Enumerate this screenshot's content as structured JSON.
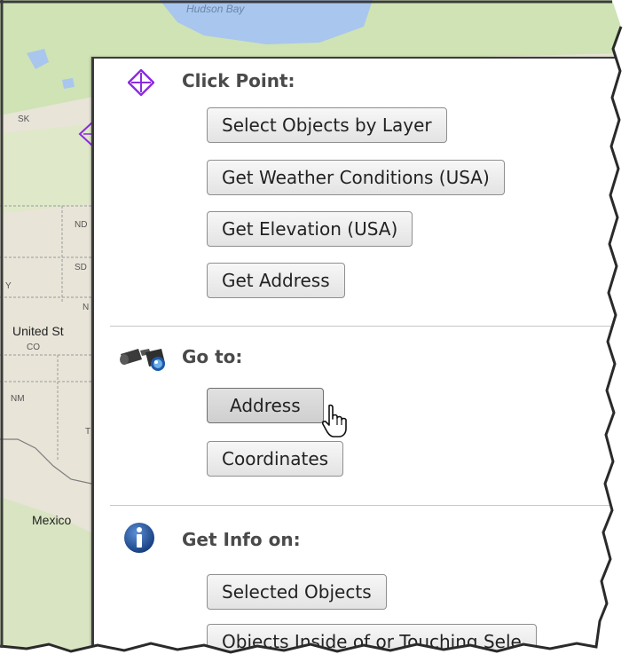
{
  "map": {
    "labels": {
      "hudson_bay": "Hudson Bay",
      "sk": "SK",
      "nd": "ND",
      "sd": "SD",
      "wy": "Y",
      "ne": "N",
      "united_states": "United St",
      "co": "CO",
      "nm": "NM",
      "tx": "T",
      "mexico": "Mexico"
    }
  },
  "menu": {
    "sections": [
      {
        "title": "Click Point:",
        "icon": "diamond-crosshair-icon",
        "buttons": [
          "Select Objects by Layer",
          "Get Weather Conditions (USA)",
          "Get Elevation (USA)",
          "Get Address"
        ]
      },
      {
        "title": "Go to:",
        "icon": "binoculars-icon",
        "buttons": [
          "Address",
          "Coordinates"
        ]
      },
      {
        "title": "Get Info on:",
        "icon": "info-icon",
        "buttons": [
          "Selected Objects",
          "Objects Inside of or Touching Sele"
        ]
      }
    ]
  },
  "colors": {
    "click_point_icon": "#8b2be2",
    "info_icon": "#1f4f96",
    "map_land": "#e8e4d8",
    "map_water": "#a9c6ee",
    "map_green": "#cfe3b5"
  }
}
